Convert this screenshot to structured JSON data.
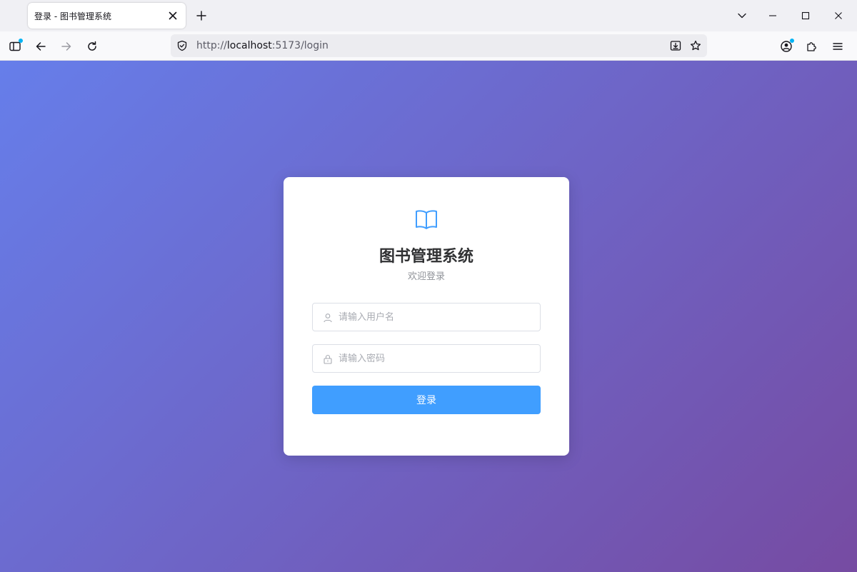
{
  "browser": {
    "tab_title": "登录 - 图书管理系统",
    "url_prefix": "http://",
    "url_host": "localhost",
    "url_rest": ":5173/login"
  },
  "icons": {
    "tab_close": "close-icon",
    "new_tab": "plus-icon",
    "list_tabs": "chevron-down-icon",
    "minimize": "minimize-icon",
    "maximize": "maximize-icon",
    "close_window": "close-icon",
    "sidebar": "sidebar-icon",
    "back": "arrow-left-icon",
    "forward": "arrow-right-icon",
    "reload": "reload-icon",
    "tracking": "shield-icon",
    "save": "download-icon",
    "bookmark": "star-icon",
    "account": "account-icon",
    "extensions": "puzzle-icon",
    "menu": "hamburger-icon",
    "logo": "book-icon",
    "username": "user-icon",
    "password": "lock-icon"
  },
  "colors": {
    "gradient_start": "#667eea",
    "gradient_end": "#764ba2",
    "primary": "#409eff",
    "logo": "#409eff",
    "title": "#303133",
    "subtitle": "#909399"
  },
  "login": {
    "title": "图书管理系统",
    "subtitle": "欢迎登录",
    "username_placeholder": "请输入用户名",
    "username_value": "",
    "password_placeholder": "请输入密码",
    "password_value": "",
    "submit_label": "登录"
  }
}
